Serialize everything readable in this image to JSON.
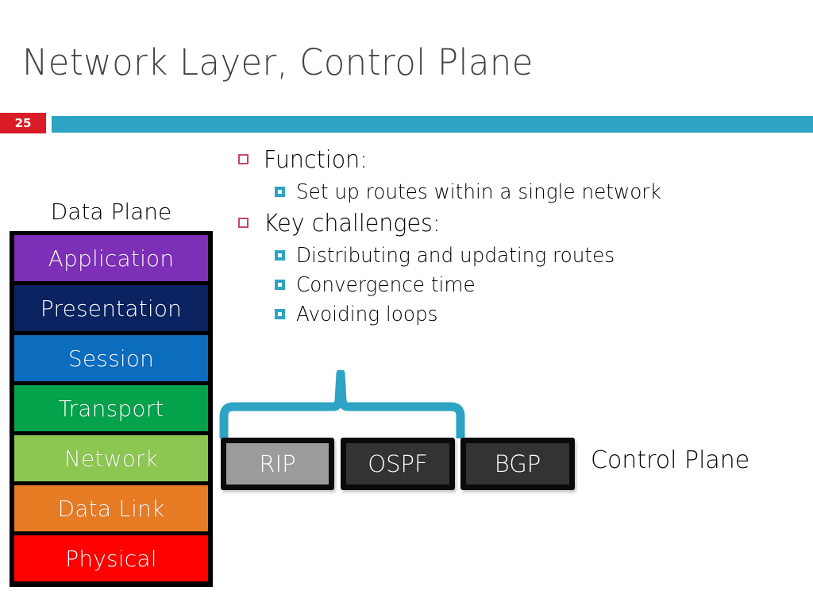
{
  "slide": {
    "title": "Network Layer, Control Plane",
    "number": "25",
    "accent_color": "#2EA3C4",
    "badge_color": "#D91C26",
    "title_color": "#434343"
  },
  "bullets": [
    {
      "level": 1,
      "text": "Function:"
    },
    {
      "level": 2,
      "text": "Set up routes within a single network"
    },
    {
      "level": 1,
      "text": "Key challenges:"
    },
    {
      "level": 2,
      "text": "Distributing and updating routes"
    },
    {
      "level": 2,
      "text": "Convergence time"
    },
    {
      "level": 2,
      "text": "Avoiding loops"
    }
  ],
  "data_plane": {
    "label": "Data Plane",
    "layers": [
      {
        "name": "Application",
        "color": "#7D2FB8"
      },
      {
        "name": "Presentation",
        "color": "#0A2260"
      },
      {
        "name": "Session",
        "color": "#0C6CBE"
      },
      {
        "name": "Transport",
        "color": "#05A24C"
      },
      {
        "name": "Network",
        "color": "#8CC751"
      },
      {
        "name": "Data Link",
        "color": "#E77B24"
      },
      {
        "name": "Physical",
        "color": "#FE0000"
      }
    ]
  },
  "control_plane": {
    "label": "Control Plane",
    "brace_color": "#2EA3C4",
    "protocols": [
      {
        "name": "RIP",
        "color": "#9C9C9C"
      },
      {
        "name": "OSPF",
        "color": "#333333"
      },
      {
        "name": "BGP",
        "color": "#333333"
      }
    ]
  }
}
